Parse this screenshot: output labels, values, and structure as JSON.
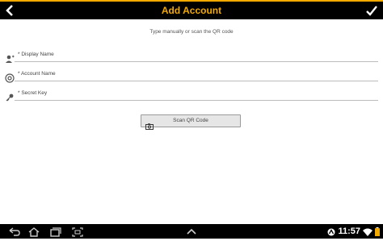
{
  "header": {
    "title": "Add Account",
    "accent_color": "#f2a900"
  },
  "main": {
    "instruction": "Type manually or scan the QR code",
    "fields": [
      {
        "placeholder": "* Display Name",
        "icon": "person-icon"
      },
      {
        "placeholder": "* Account Name",
        "icon": "at-sign-icon"
      },
      {
        "placeholder": "* Secret Key",
        "icon": "key-icon"
      }
    ],
    "scan_button_label": "Scan QR Code"
  },
  "system_bar": {
    "time": "11:57",
    "icons": [
      "back-nav-icon",
      "home-nav-icon",
      "recents-nav-icon",
      "screenshot-icon",
      "chevron-up-icon",
      "signal-icon",
      "wifi-icon",
      "battery-icon"
    ]
  }
}
